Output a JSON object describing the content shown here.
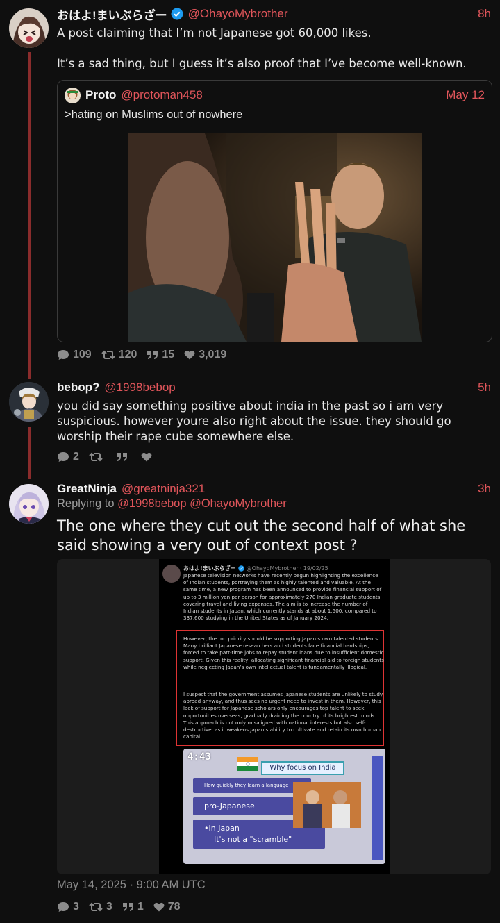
{
  "posts": [
    {
      "name": "おはよ!まいぶらざー",
      "handle": "@OhayoMybrother",
      "time": "8h",
      "text_line1": "A post claiming that I’m not Japanese got 60,000 likes.",
      "text_line2": "It’s a sad thing, but I guess it’s also proof that I’ve become well-known.",
      "quote": {
        "name": "Proto",
        "handle": "@protoman458",
        "time": "May 12",
        "text": ">hating on Muslims out of nowhere"
      },
      "stats": {
        "replies": "109",
        "retweets": "120",
        "quotes": "15",
        "likes": "3,019"
      }
    },
    {
      "name": "bebop?",
      "handle": "@1998bebop",
      "time": "5h",
      "text": "you did say something positive about india in the past so i am very suspicious. however youre also right about the issue. they should go worship their rape cube somewhere else.",
      "stats": {
        "replies": "2",
        "retweets": "",
        "quotes": "",
        "likes": ""
      }
    },
    {
      "name": "GreatNinja",
      "handle": "@greatninja321",
      "time": "3h",
      "replying_prefix": "Replying to",
      "replying_to_1": "@1998bebop",
      "replying_to_2": "@OhayoMybrother",
      "text": "The one where they cut out the second half of what she said showing a very out of context post ?",
      "date": "May 14, 2025 · 9:00 AM UTC",
      "stats": {
        "replies": "3",
        "retweets": "3",
        "quotes": "1",
        "likes": "78"
      },
      "embedded": {
        "name": "おはよ!まいぶらざー",
        "handle": "@OhayoMybrother",
        "date": "· 19/02/25",
        "para1": "Japanese television networks have recently begun highlighting the excellence of Indian students, portraying them as highly talented and valuable. At the same time, a new program has been announced to provide financial support of up to 3 million yen per person for approximately 270 Indian graduate students, covering travel and living expenses. The aim is to increase the number of Indian students in Japan, which currently stands at about 1,500, compared to 337,600 studying in the United States as of January 2024.",
        "para2": "However, the top priority should be supporting Japan’s own talented students. Many brilliant Japanese researchers and students face financial hardships, forced to take part-time jobs to repay student loans due to insufficient domestic support. Given this reality, allocating significant financial aid to foreign students while neglecting Japan’s own intellectual talent is fundamentally illogical.",
        "para3": "I suspect that the government assumes Japanese students are unlikely to study abroad anyway, and thus sees no urgent need to invest in them. However, this lack of support for Japanese scholars only encourages top talent to seek opportunities overseas, gradually draining the country of its brightest minds. This approach is not only misaligned with national interests but also self-destructive, as it weakens Japan’s ability to cultivate and retain its own human capital.",
        "tv_clock": "4:43",
        "tv_title": "Why focus on India",
        "tv_item1": "How quickly they learn a language",
        "tv_item2": "pro-Japanese",
        "tv_item3": "•In Japan",
        "tv_item4": "It's not a \"scramble\""
      }
    }
  ]
}
